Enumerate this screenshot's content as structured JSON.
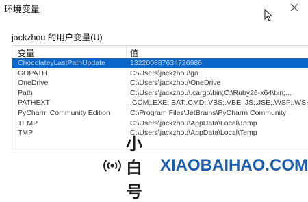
{
  "window": {
    "title": "环境变量"
  },
  "user_vars": {
    "group_label": "jackzhou 的用户变量(U)",
    "columns": {
      "name": "变量",
      "value": "值"
    },
    "rows": [
      {
        "name": "ChocolateyLastPathUpdate",
        "value": "132200887634726986",
        "selected": true
      },
      {
        "name": "GOPATH",
        "value": "C:\\Users\\jackzhou\\go"
      },
      {
        "name": "OneDrive",
        "value": "C:\\Users\\jackzhou\\OneDrive"
      },
      {
        "name": "Path",
        "value": "C:\\Users\\jackzhou\\.cargo\\bin;C:\\Ruby26-x64\\bin;..."
      },
      {
        "name": "PATHEXT",
        "value": ".COM;.EXE;.BAT;.CMD;.VBS;.VBE;.JS;.JSE;.WSF;.WSH"
      },
      {
        "name": "PyCharm Community Edition",
        "value": "C:\\Program Files\\JetBrains\\PyCharm Community"
      },
      {
        "name": "TEMP",
        "value": "C:\\Users\\jackzhou\\AppData\\Local\\Temp"
      },
      {
        "name": "TMP",
        "value": "C:\\Users\\jackzhou\\AppData\\Local\\Temp"
      }
    ]
  },
  "watermark": {
    "cn": "小白号",
    "en": "XIAOBAIHAO.COM"
  }
}
